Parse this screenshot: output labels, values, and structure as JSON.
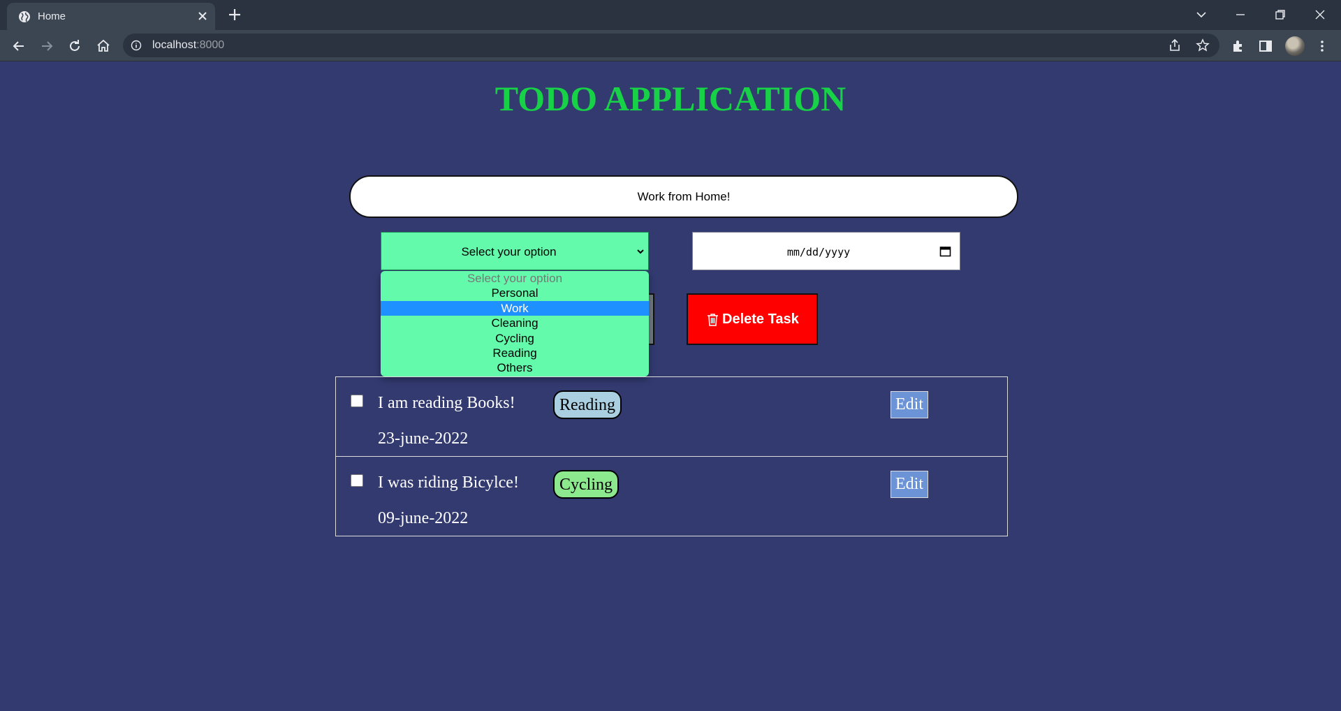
{
  "browser": {
    "tab_title": "Home",
    "url_host": "localhost",
    "url_port": ":8000"
  },
  "app": {
    "title": "TODO APPLICATION",
    "task_input_value": "Work from Home!",
    "category_select": {
      "selected": "Select your option",
      "options": [
        "Select your option",
        "Personal",
        "Work",
        "Cleaning",
        "Cycling",
        "Reading",
        "Others"
      ],
      "highlighted": "Work"
    },
    "date_input_placeholder": "mm/dd/yyyy",
    "delete_button_label": "Delete Task",
    "tasks": [
      {
        "text": "I am reading Books!",
        "category": "Reading",
        "date": "23-june-2022",
        "edit_label": "Edit",
        "badge_color": "#a9cfe0"
      },
      {
        "text": "I was riding Bicylce!",
        "category": "Cycling",
        "date": "09-june-2022",
        "edit_label": "Edit",
        "badge_color": "#8ce98e"
      }
    ]
  },
  "colors": {
    "background": "#323a70",
    "title": "#17d247",
    "select_bg": "#63fbab",
    "delete_bg": "#ff0000",
    "edit_bg": "#6b93d6",
    "option_highlight": "#1e90ff"
  }
}
